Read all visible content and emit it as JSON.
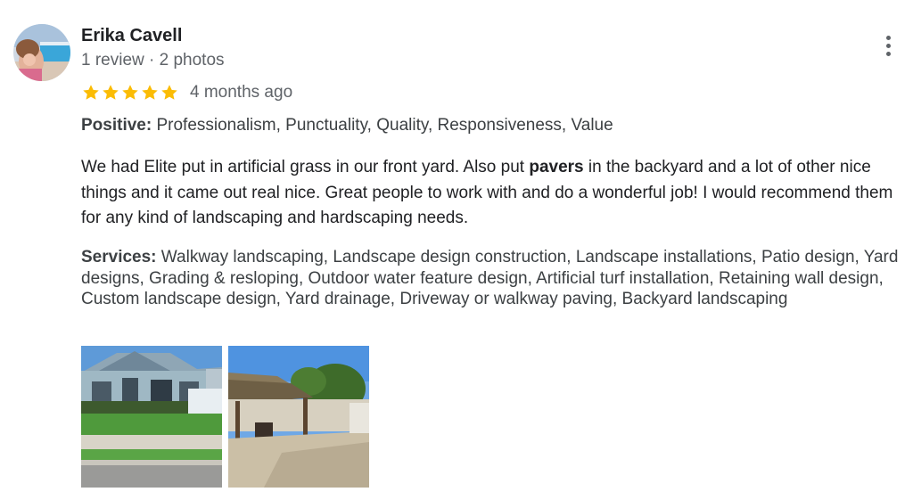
{
  "reviewer": {
    "name": "Erika Cavell",
    "meta": "1 review · 2 photos",
    "avatar_icon": "profile-photo-icon"
  },
  "rating": {
    "stars": 5,
    "max_stars": 5,
    "star_color": "#fbbc04",
    "time_ago": "4 months ago"
  },
  "positive": {
    "label": "Positive:",
    "text": "Professionalism, Punctuality, Quality, Responsiveness, Value"
  },
  "review": {
    "text_before": "We had Elite put in artificial grass in our front yard. Also put ",
    "bold": "pavers",
    "text_after": " in the backyard and a lot of other nice things and it came out real nice. Great people to work with and do a wonderful job! I would recommend them for any kind of landscaping and hardscaping needs."
  },
  "services": {
    "label": "Services:",
    "text": "Walkway landscaping, Landscape design construction, Landscape installations, Patio design, Yard designs, Grading & resloping, Outdoor water feature design, Artificial turf installation, Retaining wall design, Custom landscape design, Yard drainage, Driveway or walkway paving, Backyard landscaping"
  },
  "photos": [
    {
      "icon": "front-yard-house-photo"
    },
    {
      "icon": "backyard-patio-pergola-photo"
    }
  ],
  "menu_icon": "more-vertical-icon"
}
